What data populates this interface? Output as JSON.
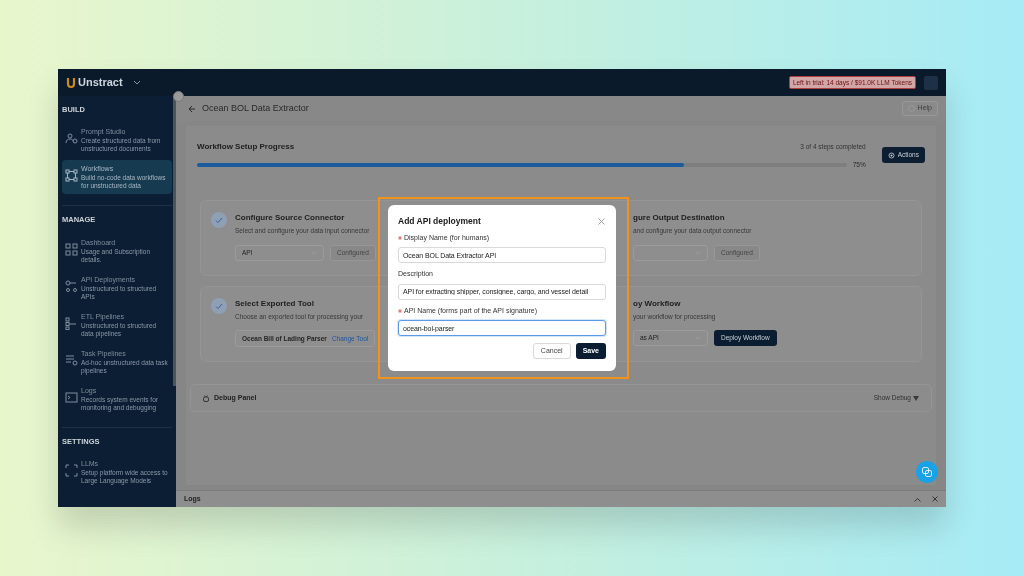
{
  "header": {
    "logo": "Unstract",
    "trial_badge": "Left in trial: 14 days / $91.0K LLM Tokens"
  },
  "sidebar": {
    "sections": [
      {
        "title": "BUILD",
        "items": [
          {
            "label": "Prompt Studio",
            "description": "Create structured data from unstructured documents",
            "selected": false
          },
          {
            "label": "Workflows",
            "description": "Build no-code data workflows for unstructured data",
            "selected": true
          }
        ]
      },
      {
        "title": "MANAGE",
        "items": [
          {
            "label": "Dashboard",
            "description": "Usage and Subscription details.",
            "selected": false
          },
          {
            "label": "API Deployments",
            "description": "Unstructured to structured APIs",
            "selected": false
          },
          {
            "label": "ETL Pipelines",
            "description": "Unstructured to structured data pipelines",
            "selected": false
          },
          {
            "label": "Task Pipelines",
            "description": "Ad-hoc unstructured data task pipelines",
            "selected": false
          },
          {
            "label": "Logs",
            "description": "Records system events for monitoring and debugging",
            "selected": false
          }
        ]
      },
      {
        "title": "SETTINGS",
        "items": [
          {
            "label": "LLMs",
            "description": "Setup platform wide access to Large Language Models",
            "selected": false
          }
        ]
      }
    ]
  },
  "page": {
    "title": "Ocean BOL Data Extractor",
    "help_button": "Help"
  },
  "progress": {
    "title": "Workflow Setup Progress",
    "steps_text": "3 of 4 steps completed",
    "level": 0.75,
    "percent": "75%",
    "actions_button": "Actions"
  },
  "step_rows": [
    {
      "left": {
        "kind": "connector",
        "checked": true,
        "title": "Configure Source Connector",
        "subtitle": "Select and configure your data input connector",
        "select": "API",
        "status_button": "Configured"
      },
      "right": {
        "title": "gure Output Destination",
        "subtitle": "and configure your data output connector",
        "status_button": "Configured"
      }
    },
    {
      "left": {
        "kind": "tool",
        "checked": true,
        "title": "Select Exported Tool",
        "subtitle": "Choose an exported tool for processing your",
        "tool": "Ocean Bill of Lading Parser",
        "link": "Change Tool"
      },
      "right": {
        "title": "oy Workflow",
        "subtitle": "your workflow for processing",
        "select": "as API",
        "action_button": "Deploy Workflow"
      }
    }
  ],
  "debug_panel": {
    "title": "Debug Panel",
    "toggle": "Show Debug"
  },
  "logs_bar": {
    "title": "Logs"
  },
  "dialog": {
    "title": "Add API deployment",
    "fields": [
      {
        "label": "Display Name (for humans)",
        "required": true,
        "value": "Ocean BOL Data Extractor API",
        "focused": false
      },
      {
        "label": "Description",
        "required": false,
        "value": "API for extracting shipper, consignee, cargo, and vessel detail",
        "focused": false
      },
      {
        "label": "API Name (forms part of the API signature)",
        "required": true,
        "value": "ocean-bol-parser",
        "focused": true
      }
    ],
    "buttons": [
      {
        "label": "Cancel",
        "primary": false
      },
      {
        "label": "Save",
        "primary": true
      }
    ]
  }
}
